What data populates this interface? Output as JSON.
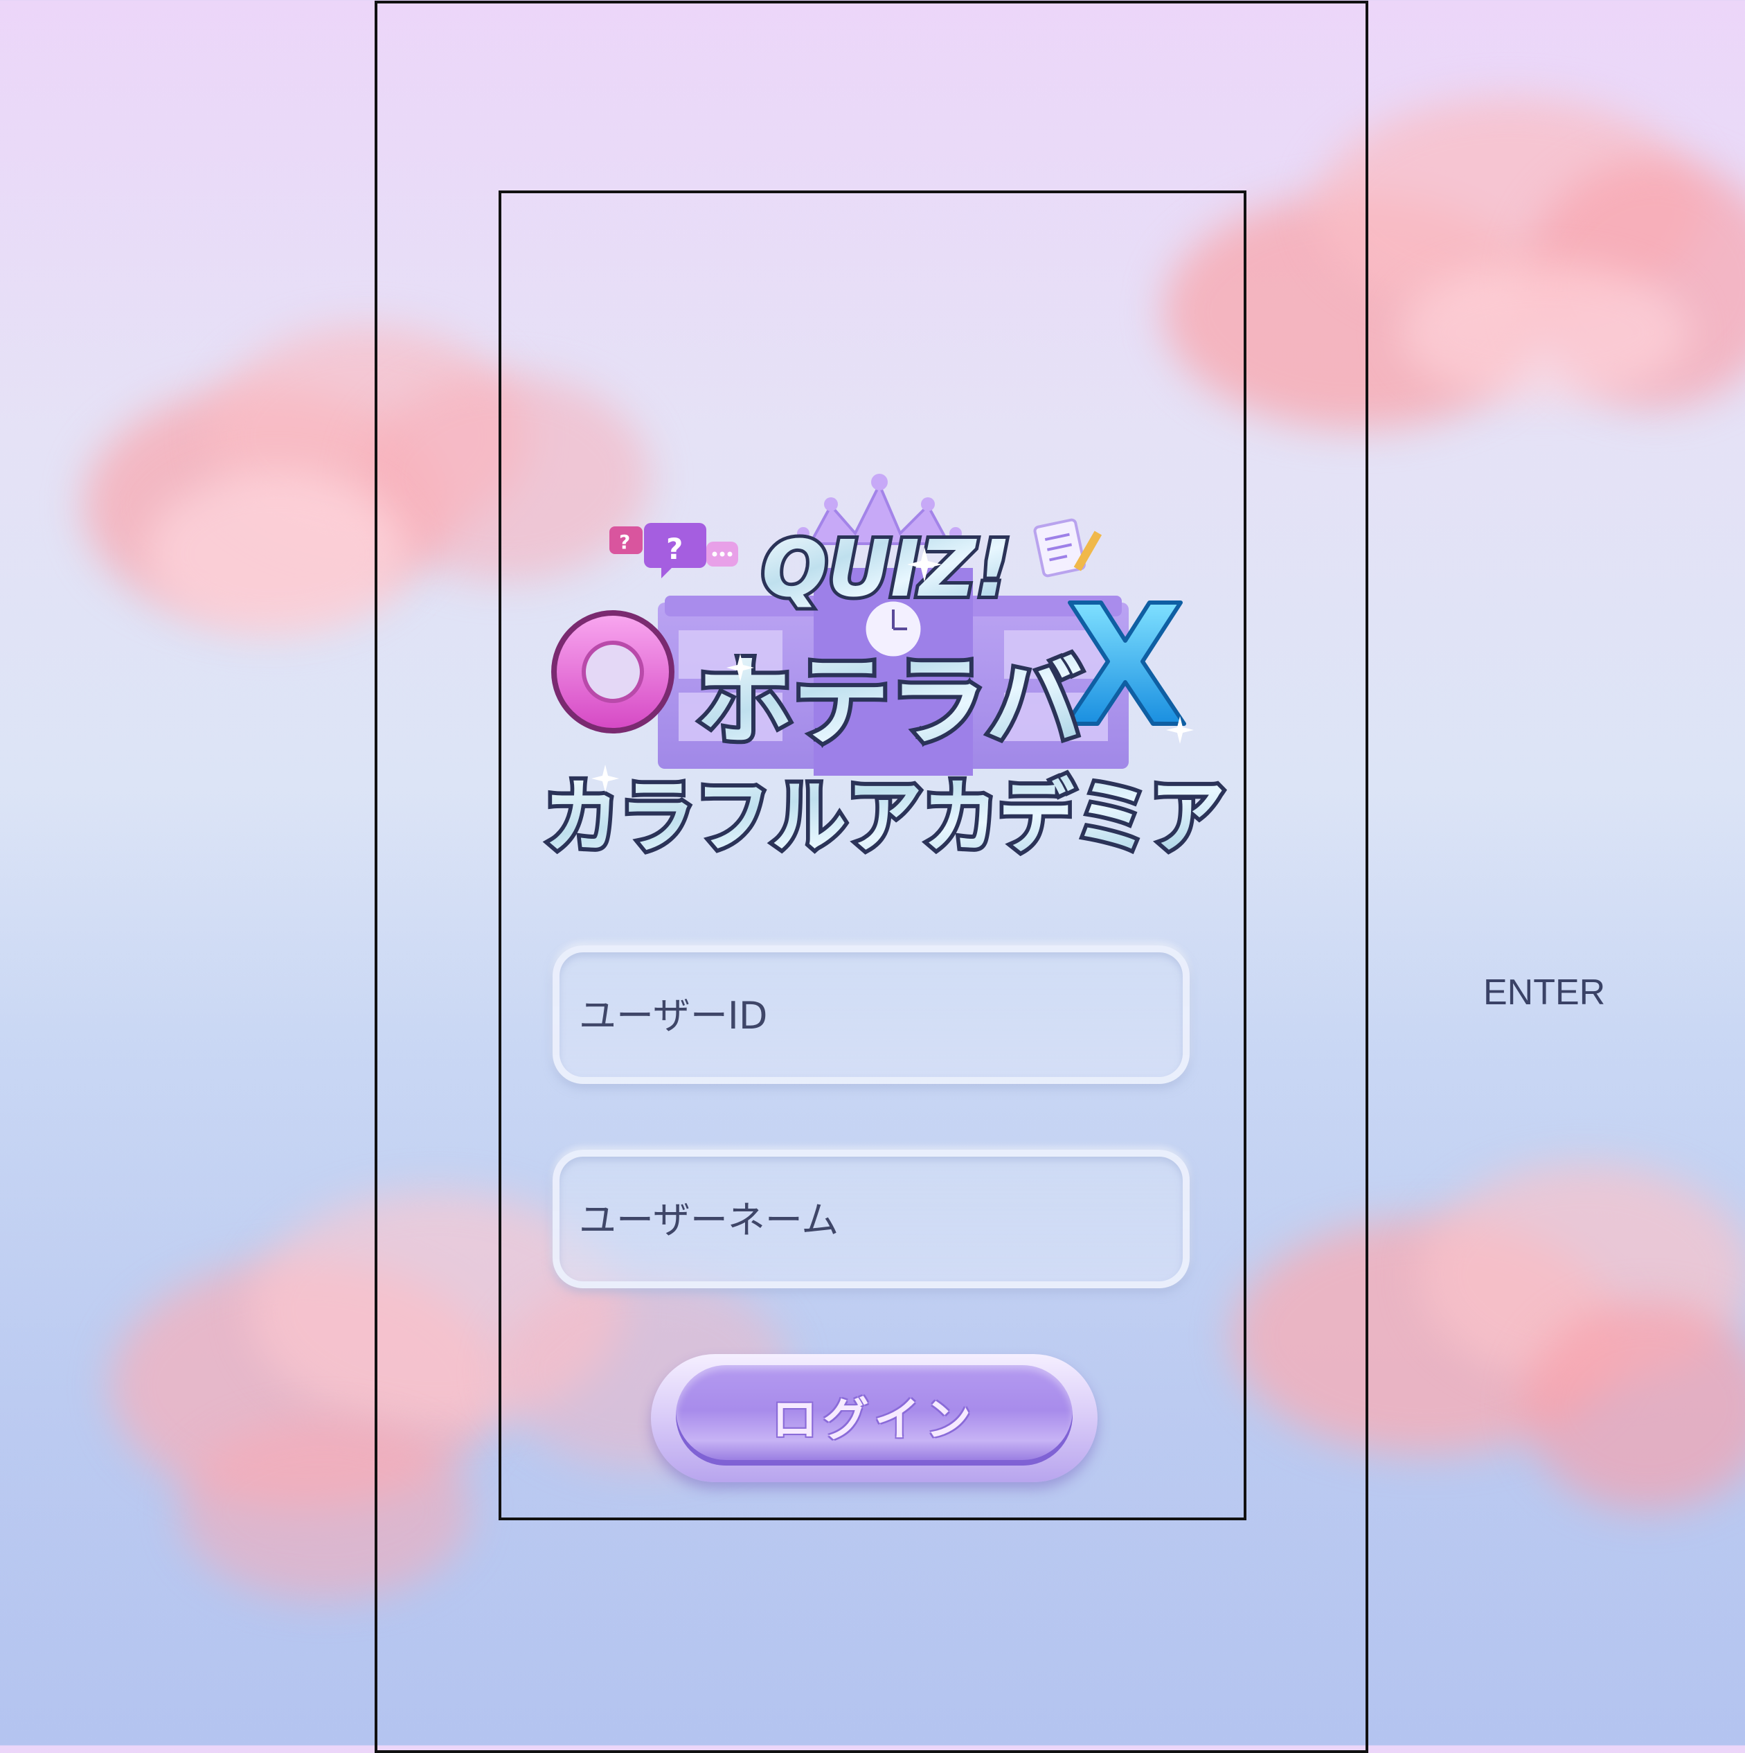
{
  "logo": {
    "top_text": "QUIZ!",
    "circle_symbol": "O",
    "cross_symbol": "X",
    "line1": "ホテラバ",
    "line2": "カラフルアカデミア",
    "icons": [
      "question-bubble-icon",
      "chat-bubble-icon",
      "crown-icon",
      "clock-icon",
      "notepad-pencil-icon",
      "school-building-icon"
    ]
  },
  "form": {
    "user_id_placeholder": "ユーザーID",
    "user_name_placeholder": "ユーザーネーム",
    "login_label": "ログイン"
  },
  "side": {
    "enter_label": "ENTER"
  },
  "colors": {
    "background_top": "#ecd6f9",
    "background_bottom": "#b4c4f0",
    "cloud": "#f7a9b0",
    "button": "#a88ceb",
    "text": "#3a4266"
  }
}
